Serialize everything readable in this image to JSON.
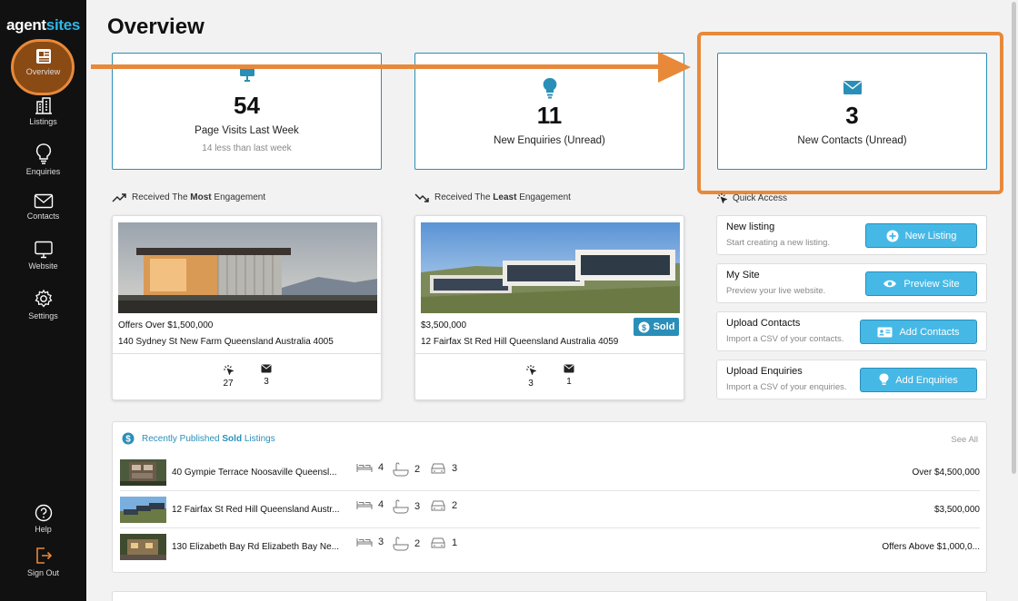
{
  "sidebar": {
    "logo_part1": "agent",
    "logo_part2": "sites",
    "items": [
      {
        "label": "Overview",
        "icon": "newspaper-icon"
      },
      {
        "label": "Listings",
        "icon": "building-icon"
      },
      {
        "label": "Enquiries",
        "icon": "lightbulb-icon"
      },
      {
        "label": "Contacts",
        "icon": "envelope-icon"
      },
      {
        "label": "Website",
        "icon": "monitor-icon"
      },
      {
        "label": "Settings",
        "icon": "gear-icon"
      }
    ],
    "help_label": "Help",
    "signout_label": "Sign Out"
  },
  "page": {
    "title": "Overview"
  },
  "stats": [
    {
      "number": "54",
      "label": "Page Visits Last Week",
      "sub": "14 less than last week",
      "icon": "monitor-icon"
    },
    {
      "number": "11",
      "label": "New Enquiries (Unread)",
      "icon": "lightbulb-icon"
    },
    {
      "number": "3",
      "label": "New Contacts (Unread)",
      "icon": "envelope-icon"
    }
  ],
  "most": {
    "pre": "Received The ",
    "bold": "Most",
    "post": " Engagement",
    "price": "Offers Over $1,500,000",
    "address": "140 Sydney St New Farm Queensland Australia 4005",
    "clicks": "27",
    "messages": "3"
  },
  "least": {
    "pre": "Received The ",
    "bold": "Least",
    "post": " Engagement",
    "price": "$3,500,000",
    "address": "12 Fairfax St Red Hill Queensland Australia 4059",
    "clicks": "3",
    "messages": "1",
    "badge": "Sold"
  },
  "quick_access": {
    "title": "Quick Access",
    "items": [
      {
        "title": "New listing",
        "sub": "Start creating a new listing.",
        "button": "New Listing"
      },
      {
        "title": "My Site",
        "sub": "Preview your live website.",
        "button": "Preview Site"
      },
      {
        "title": "Upload Contacts",
        "sub": "Import a CSV of your contacts.",
        "button": "Add Contacts"
      },
      {
        "title": "Upload Enquiries",
        "sub": "Import a CSV of your enquiries.",
        "button": "Add Enquiries"
      }
    ]
  },
  "sold": {
    "pre": "Recently Published ",
    "bold": "Sold",
    "post": " Listings",
    "see_all": "See All",
    "rows": [
      {
        "address": "40 Gympie Terrace Noosaville Queensl...",
        "beds": "4",
        "baths": "2",
        "cars": "3",
        "price": "Over $4,500,000"
      },
      {
        "address": "12 Fairfax St Red Hill Queensland Austr...",
        "beds": "4",
        "baths": "3",
        "cars": "2",
        "price": "$3,500,000"
      },
      {
        "address": "130 Elizabeth Bay Rd Elizabeth Bay Ne...",
        "beds": "3",
        "baths": "2",
        "cars": "1",
        "price": "Offers Above $1,000,0..."
      }
    ]
  },
  "colors": {
    "accent": "#2a8fb8",
    "highlight": "#e8893a",
    "button": "#46b8e6",
    "sidebar": "#111111"
  }
}
